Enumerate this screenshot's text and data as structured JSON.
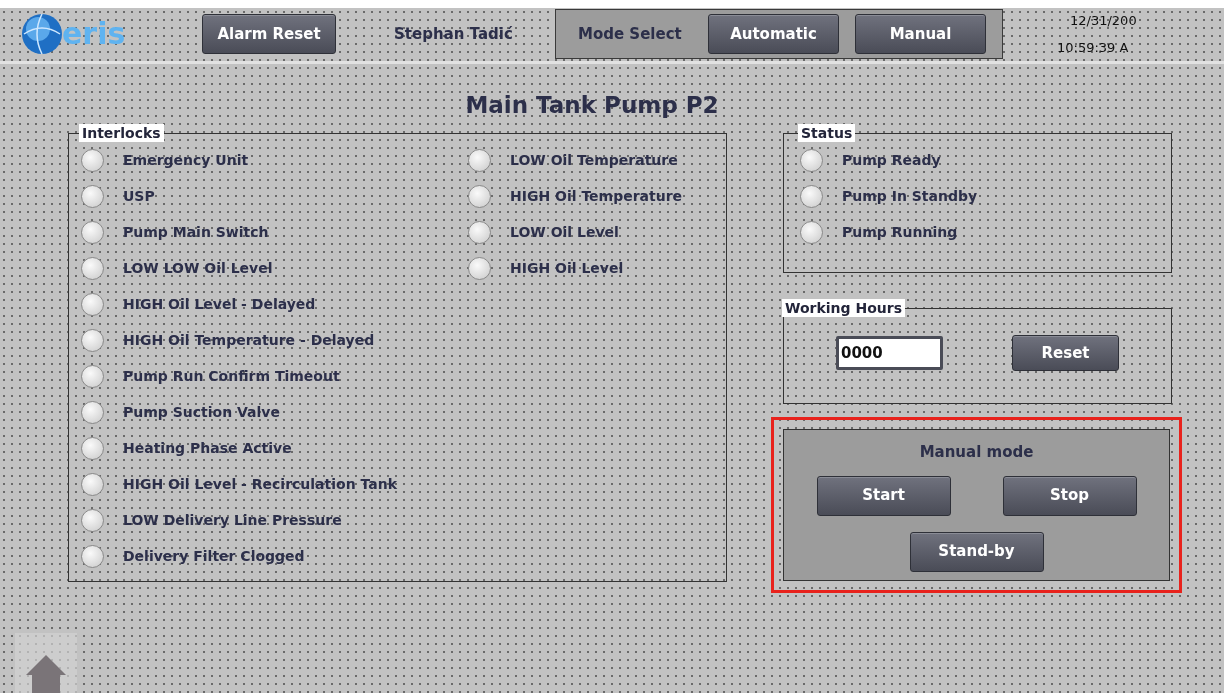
{
  "header": {
    "logo_text": "eris",
    "alarm_reset": "Alarm Reset",
    "user": "Stephan Tadić",
    "mode_select": {
      "label": "Mode Select",
      "buttons": [
        "Automatic",
        "Manual"
      ]
    },
    "date": "12/31/200",
    "time": "10:59:39 A"
  },
  "title": "Main Tank Pump P2",
  "interlocks": {
    "title": "Interlocks",
    "columns": [
      [
        {
          "label": "Emergency Unit",
          "lit": false
        },
        {
          "label": "USP",
          "lit": false
        },
        {
          "label": "Pump Main Switch",
          "lit": false
        },
        {
          "label": "LOW LOW Oil Level",
          "lit": false
        },
        {
          "label": "HIGH Oil Level - Delayed",
          "lit": false
        },
        {
          "label": "HIGH Oil Temperature - Delayed",
          "lit": false
        },
        {
          "label": "Pump Run Confirm Timeout",
          "lit": false
        },
        {
          "label": "Pump Suction Valve",
          "lit": false
        },
        {
          "label": "Heating Phase Active",
          "lit": false
        },
        {
          "label": "HIGH Oil Level - Recirculation Tank",
          "lit": false
        },
        {
          "label": "LOW Delivery Line Pressure",
          "lit": false
        },
        {
          "label": "Delivery Filter Clogged",
          "lit": false
        }
      ],
      [
        {
          "label": "LOW Oil Temperature",
          "lit": false
        },
        {
          "label": "HIGH Oil Temperature",
          "lit": false
        },
        {
          "label": "LOW Oil Level",
          "lit": false
        },
        {
          "label": "HIGH Oil Level",
          "lit": false
        }
      ]
    ]
  },
  "status": {
    "title": "Status",
    "items": [
      {
        "label": "Pump Ready",
        "lit": false
      },
      {
        "label": "Pump In Standby",
        "lit": false
      },
      {
        "label": "Pump Running",
        "lit": false
      }
    ]
  },
  "working_hours": {
    "title": "Working Hours",
    "value": "0000",
    "reset": "Reset"
  },
  "manual_mode": {
    "title": "Manual mode",
    "buttons": [
      "Start",
      "Stop",
      "Stand-by"
    ]
  }
}
